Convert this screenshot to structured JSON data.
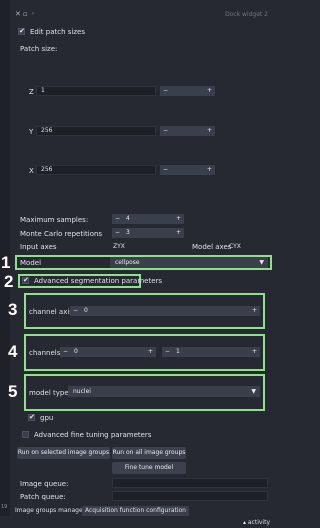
{
  "titlebar": {
    "icons": [
      "close-icon",
      "float-icon",
      "pin-icon"
    ],
    "title": "Dock widget 2"
  },
  "edit_patch_sizes": {
    "label": "Edit patch sizes",
    "checked": true
  },
  "patch_size": {
    "label": "Patch size:",
    "z": {
      "axis": "Z",
      "value": "1"
    },
    "y": {
      "axis": "Y",
      "value": "256"
    },
    "x": {
      "axis": "X",
      "value": "256"
    }
  },
  "max_samples": {
    "label": "Maximum samples:",
    "value": "4"
  },
  "monte_carlo": {
    "label": "Monte Carlo repetitions",
    "value": "3"
  },
  "axes": {
    "input_label": "Input axes",
    "input_value": "ZYX",
    "model_label": "Model axes",
    "model_value": "CYX"
  },
  "model": {
    "label": "Model",
    "value": "cellpose"
  },
  "advanced_seg": {
    "label": "Advanced segmentation parameters",
    "checked": true
  },
  "channel_axis": {
    "label": "channel axis",
    "value": "0"
  },
  "channels": {
    "label": "channels",
    "value1": "0",
    "value2": "1"
  },
  "model_type": {
    "label": "model type",
    "value": "nuclei"
  },
  "gpu": {
    "label": "gpu",
    "checked": true
  },
  "advanced_fine": {
    "label": "Advanced fine tuning parameters",
    "checked": false
  },
  "buttons": {
    "run_selected": "Run on selected image groups",
    "run_all": "Run on all image groups",
    "fine_tune": "Fine tune model"
  },
  "image_queue": {
    "label": "Image queue:"
  },
  "patch_queue": {
    "label": "Patch queue:"
  },
  "tabs": [
    "Image groups manager",
    "Acquisition function configuration"
  ],
  "status": {
    "activity": "activity"
  },
  "annotations": [
    "1",
    "2",
    "3",
    "4",
    "5"
  ],
  "left_strip": {
    "value": "19"
  },
  "colors": {
    "highlight": "#8ee08a",
    "background": "#262931",
    "input": "#3a3f4b"
  }
}
